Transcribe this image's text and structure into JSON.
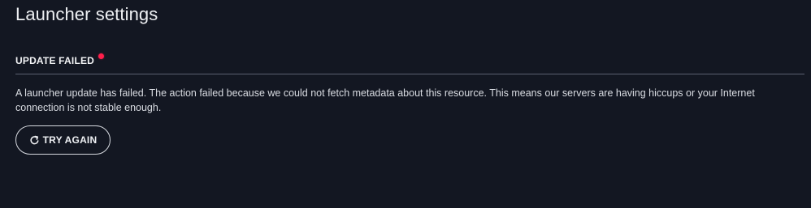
{
  "page": {
    "title": "Launcher settings"
  },
  "update_section": {
    "title": "UPDATE FAILED",
    "status_color": "#ff1f4b",
    "message": "A launcher update has failed. The action failed because we could not fetch metadata about this resource. This means our servers are having hiccups or your Internet connection is not stable enough.",
    "retry_button": {
      "label": "TRY AGAIN",
      "icon": "refresh-icon"
    }
  },
  "colors": {
    "background": "#131722",
    "divider": "#5b6070",
    "text": "#d9dce2",
    "button_border": "#d6d9df"
  }
}
